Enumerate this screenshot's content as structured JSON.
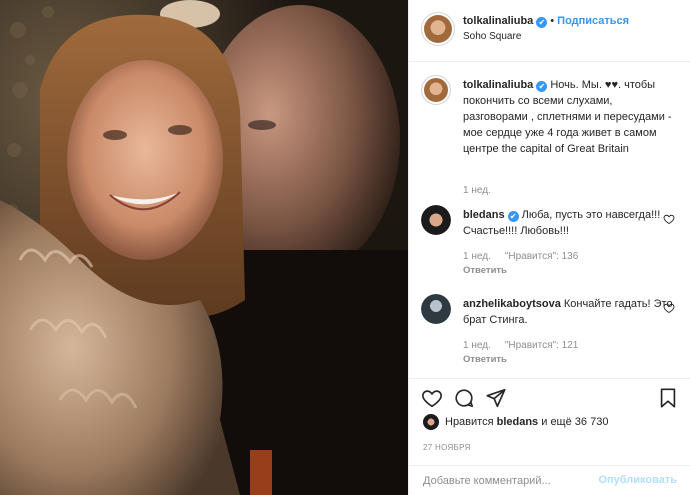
{
  "post": {
    "username": "tolkalinaliuba",
    "verified_mark": "✔",
    "separator": "•",
    "follow_label": "Подписаться",
    "location": "Soho Square",
    "photo_icon": "selfie-photo"
  },
  "caption": {
    "username": "tolkalinaliuba",
    "text": " Ночь. Мы. ♥♥. чтобы покончить со всеми слухами, разговорами , сплетнями и пересудами - мое сердце уже 4 года живет в самом центре the capital of Great Britain",
    "time": "1 нед."
  },
  "comments": [
    {
      "username": "bledans",
      "text": " Люба, пусть это навсегда!!! Счастье!!!! Любовь!!!",
      "time": "1 нед.",
      "likes": "\"Нравится\": 136",
      "reply": "Ответить"
    },
    {
      "username": "anzhelikaboytsova",
      "text": " Кончайте гадать! Это брат Стинга.",
      "time": "1 нед.",
      "likes": "\"Нравится\": 121",
      "reply": "Ответить"
    }
  ],
  "actions": {
    "like_icon": "heart-icon",
    "comment_icon": "comment-icon",
    "share_icon": "share-icon",
    "save_icon": "bookmark-icon"
  },
  "likes": {
    "prefix": "Нравится ",
    "user": "bledans",
    "suffix": " и ещё 36 730"
  },
  "date": "27 НОЯБРЯ",
  "add_comment": {
    "placeholder": "Добавьте комментарий...",
    "publish_label": "Опубликовать"
  },
  "colors": {
    "accent": "#3897f0",
    "muted": "#8e8e8e",
    "publish_disabled": "#b2dffc"
  }
}
